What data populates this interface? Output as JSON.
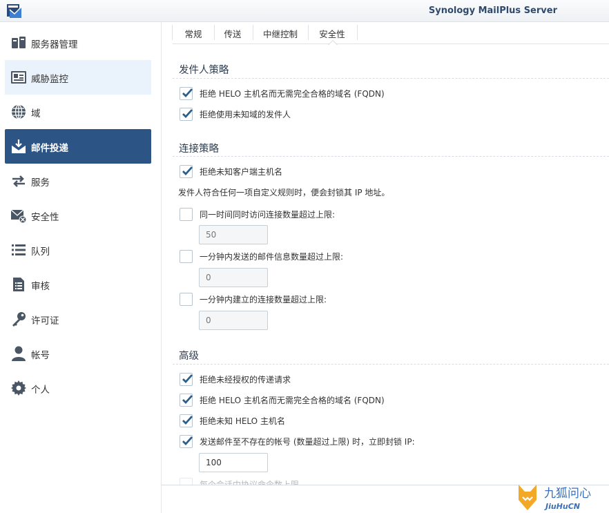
{
  "app": {
    "title": "Synology MailPlus Server"
  },
  "sidebar": {
    "items": [
      {
        "label": "服务器管理",
        "icon": "server-management-icon"
      },
      {
        "label": "威胁监控",
        "icon": "threat-monitor-icon"
      },
      {
        "label": "域",
        "icon": "globe-icon"
      },
      {
        "label": "邮件投递",
        "icon": "mail-delivery-icon"
      },
      {
        "label": "服务",
        "icon": "exchange-arrows-icon"
      },
      {
        "label": "安全性",
        "icon": "mail-security-icon"
      },
      {
        "label": "队列",
        "icon": "list-icon"
      },
      {
        "label": "审核",
        "icon": "audit-document-icon"
      },
      {
        "label": "许可证",
        "icon": "key-icon"
      },
      {
        "label": "帐号",
        "icon": "user-icon"
      },
      {
        "label": "个人",
        "icon": "gear-icon"
      }
    ],
    "active_index": 3,
    "hover_index": 1
  },
  "tabs": [
    {
      "label": "常规"
    },
    {
      "label": "传送"
    },
    {
      "label": "中继控制"
    },
    {
      "label": "安全性"
    }
  ],
  "active_tab": "安全性",
  "sender_policy": {
    "title": "发件人策略",
    "options": [
      {
        "label": "拒绝 HELO 主机名而无需完全合格的域名 (FQDN)",
        "checked": true
      },
      {
        "label": "拒绝使用未知域的发件人",
        "checked": true
      }
    ]
  },
  "connection_policy": {
    "title": "连接策略",
    "reject_unknown_client": {
      "label": "拒绝未知客户端主机名",
      "checked": true
    },
    "note": "发件人符合任何一项自定义规则时，便会封锁其 IP 地址。",
    "rules": [
      {
        "label": "同一时间同时访问连接数量超过上限:",
        "checked": false,
        "value": "50"
      },
      {
        "label": "一分钟内发送的邮件信息数量超过上限:",
        "checked": false,
        "value": "0"
      },
      {
        "label": "一分钟内建立的连接数量超过上限:",
        "checked": false,
        "value": "0"
      }
    ]
  },
  "advanced": {
    "title": "高级",
    "options": [
      {
        "label": "拒绝未经授权的传递请求",
        "checked": true
      },
      {
        "label": "拒绝 HELO 主机名而无需完全合格的域名 (FQDN)",
        "checked": true
      },
      {
        "label": "拒绝未知 HELO 主机名",
        "checked": true
      },
      {
        "label": "发送邮件至不存在的帐号 (数量超过上限) 时，立即封锁 IP:",
        "checked": true
      }
    ],
    "block_ip_value": "100",
    "partial_label": "每个会话中协议命令数上限"
  },
  "watermark": {
    "text": "九狐问心",
    "sub": "JiuHuCN"
  },
  "colors": {
    "accent": "#2c5585",
    "check": "#2b5e8c",
    "hover": "#eaf2fb"
  }
}
